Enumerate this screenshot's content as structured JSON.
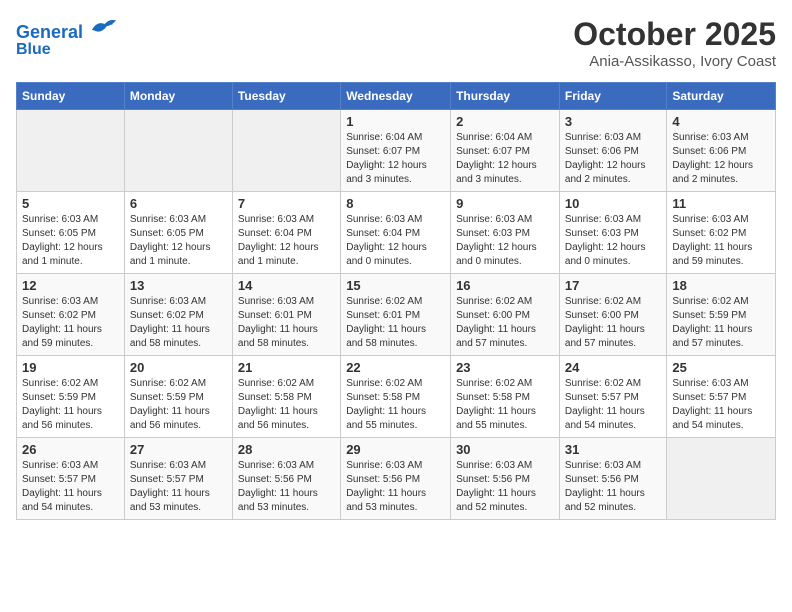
{
  "header": {
    "logo_line1": "General",
    "logo_line2": "Blue",
    "month": "October 2025",
    "location": "Ania-Assikasso, Ivory Coast"
  },
  "days_of_week": [
    "Sunday",
    "Monday",
    "Tuesday",
    "Wednesday",
    "Thursday",
    "Friday",
    "Saturday"
  ],
  "weeks": [
    [
      {
        "num": "",
        "info": ""
      },
      {
        "num": "",
        "info": ""
      },
      {
        "num": "",
        "info": ""
      },
      {
        "num": "1",
        "info": "Sunrise: 6:04 AM\nSunset: 6:07 PM\nDaylight: 12 hours and 3 minutes."
      },
      {
        "num": "2",
        "info": "Sunrise: 6:04 AM\nSunset: 6:07 PM\nDaylight: 12 hours and 3 minutes."
      },
      {
        "num": "3",
        "info": "Sunrise: 6:03 AM\nSunset: 6:06 PM\nDaylight: 12 hours and 2 minutes."
      },
      {
        "num": "4",
        "info": "Sunrise: 6:03 AM\nSunset: 6:06 PM\nDaylight: 12 hours and 2 minutes."
      }
    ],
    [
      {
        "num": "5",
        "info": "Sunrise: 6:03 AM\nSunset: 6:05 PM\nDaylight: 12 hours and 1 minute."
      },
      {
        "num": "6",
        "info": "Sunrise: 6:03 AM\nSunset: 6:05 PM\nDaylight: 12 hours and 1 minute."
      },
      {
        "num": "7",
        "info": "Sunrise: 6:03 AM\nSunset: 6:04 PM\nDaylight: 12 hours and 1 minute."
      },
      {
        "num": "8",
        "info": "Sunrise: 6:03 AM\nSunset: 6:04 PM\nDaylight: 12 hours and 0 minutes."
      },
      {
        "num": "9",
        "info": "Sunrise: 6:03 AM\nSunset: 6:03 PM\nDaylight: 12 hours and 0 minutes."
      },
      {
        "num": "10",
        "info": "Sunrise: 6:03 AM\nSunset: 6:03 PM\nDaylight: 12 hours and 0 minutes."
      },
      {
        "num": "11",
        "info": "Sunrise: 6:03 AM\nSunset: 6:02 PM\nDaylight: 11 hours and 59 minutes."
      }
    ],
    [
      {
        "num": "12",
        "info": "Sunrise: 6:03 AM\nSunset: 6:02 PM\nDaylight: 11 hours and 59 minutes."
      },
      {
        "num": "13",
        "info": "Sunrise: 6:03 AM\nSunset: 6:02 PM\nDaylight: 11 hours and 58 minutes."
      },
      {
        "num": "14",
        "info": "Sunrise: 6:03 AM\nSunset: 6:01 PM\nDaylight: 11 hours and 58 minutes."
      },
      {
        "num": "15",
        "info": "Sunrise: 6:02 AM\nSunset: 6:01 PM\nDaylight: 11 hours and 58 minutes."
      },
      {
        "num": "16",
        "info": "Sunrise: 6:02 AM\nSunset: 6:00 PM\nDaylight: 11 hours and 57 minutes."
      },
      {
        "num": "17",
        "info": "Sunrise: 6:02 AM\nSunset: 6:00 PM\nDaylight: 11 hours and 57 minutes."
      },
      {
        "num": "18",
        "info": "Sunrise: 6:02 AM\nSunset: 5:59 PM\nDaylight: 11 hours and 57 minutes."
      }
    ],
    [
      {
        "num": "19",
        "info": "Sunrise: 6:02 AM\nSunset: 5:59 PM\nDaylight: 11 hours and 56 minutes."
      },
      {
        "num": "20",
        "info": "Sunrise: 6:02 AM\nSunset: 5:59 PM\nDaylight: 11 hours and 56 minutes."
      },
      {
        "num": "21",
        "info": "Sunrise: 6:02 AM\nSunset: 5:58 PM\nDaylight: 11 hours and 56 minutes."
      },
      {
        "num": "22",
        "info": "Sunrise: 6:02 AM\nSunset: 5:58 PM\nDaylight: 11 hours and 55 minutes."
      },
      {
        "num": "23",
        "info": "Sunrise: 6:02 AM\nSunset: 5:58 PM\nDaylight: 11 hours and 55 minutes."
      },
      {
        "num": "24",
        "info": "Sunrise: 6:02 AM\nSunset: 5:57 PM\nDaylight: 11 hours and 54 minutes."
      },
      {
        "num": "25",
        "info": "Sunrise: 6:03 AM\nSunset: 5:57 PM\nDaylight: 11 hours and 54 minutes."
      }
    ],
    [
      {
        "num": "26",
        "info": "Sunrise: 6:03 AM\nSunset: 5:57 PM\nDaylight: 11 hours and 54 minutes."
      },
      {
        "num": "27",
        "info": "Sunrise: 6:03 AM\nSunset: 5:57 PM\nDaylight: 11 hours and 53 minutes."
      },
      {
        "num": "28",
        "info": "Sunrise: 6:03 AM\nSunset: 5:56 PM\nDaylight: 11 hours and 53 minutes."
      },
      {
        "num": "29",
        "info": "Sunrise: 6:03 AM\nSunset: 5:56 PM\nDaylight: 11 hours and 53 minutes."
      },
      {
        "num": "30",
        "info": "Sunrise: 6:03 AM\nSunset: 5:56 PM\nDaylight: 11 hours and 52 minutes."
      },
      {
        "num": "31",
        "info": "Sunrise: 6:03 AM\nSunset: 5:56 PM\nDaylight: 11 hours and 52 minutes."
      },
      {
        "num": "",
        "info": ""
      }
    ]
  ]
}
